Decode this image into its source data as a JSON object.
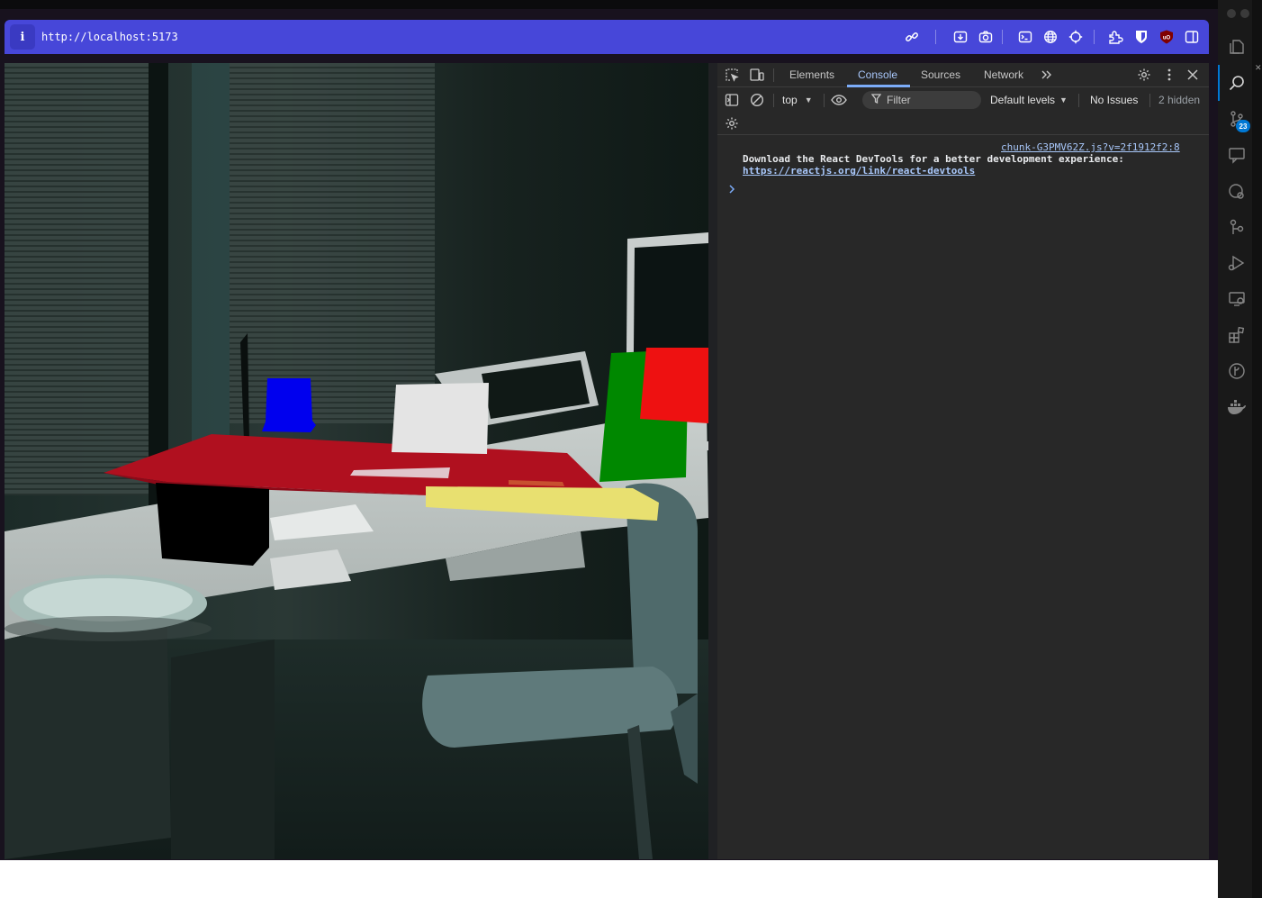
{
  "browser": {
    "url": "http://localhost:5173",
    "info_glyph": "i"
  },
  "toolbar_icons": [
    "link-icon",
    "save-page-icon",
    "camera-icon",
    "terminal-icon",
    "globe-icon",
    "crosshair-icon",
    "extensions-icon",
    "bitwarden-icon",
    "ublock-icon",
    "split-view-icon"
  ],
  "devtools": {
    "tabs": [
      {
        "label": "Elements",
        "active": false
      },
      {
        "label": "Console",
        "active": true
      },
      {
        "label": "Sources",
        "active": false
      },
      {
        "label": "Network",
        "active": false
      }
    ],
    "more_tabs_glyph": ">>",
    "context": "top",
    "filter_placeholder": "Filter",
    "levels": "Default levels",
    "issues": "No Issues",
    "hidden": "2 hidden",
    "console": {
      "source_link": "chunk-G3PMV62Z.js?v=2f1912f2:8",
      "message": "Download the React DevTools for a better development experience:",
      "link": "https://reactjs.org/link/react-devtools",
      "prompt": ">"
    }
  },
  "sidebar": {
    "badge_count": "23",
    "icons": [
      "explorer-icon",
      "search-icon",
      "source-control-icon",
      "comments-icon",
      "remote-icon",
      "extensions-tree-icon",
      "run-debug-icon",
      "remote-explorer-icon",
      "extensions-icon",
      "git-graph-icon",
      "docker-icon"
    ]
  },
  "scene": {
    "shapes": [
      "red-tabletop",
      "black-box",
      "blue-cup",
      "white-box",
      "green-panel",
      "red-panel",
      "yellow-plank"
    ],
    "colors": {
      "red": "#b0101f",
      "blue": "#0000ee",
      "green": "#008800",
      "yellow": "#e8e070",
      "white": "#e4e4e4",
      "black": "#000000"
    }
  }
}
